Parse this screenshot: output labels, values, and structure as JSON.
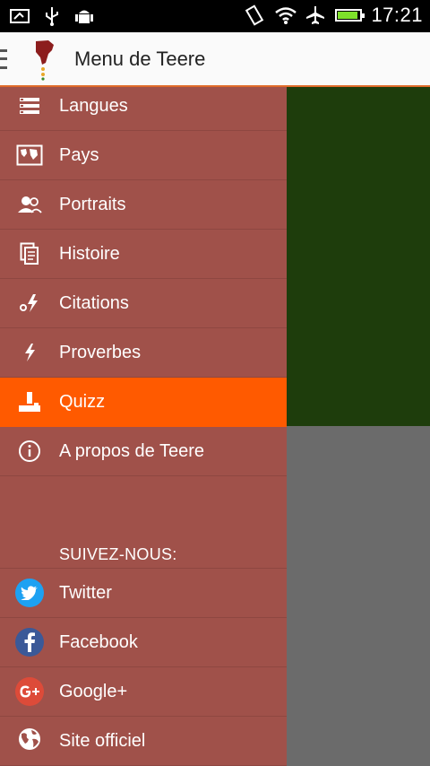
{
  "status_bar": {
    "time": "17:21",
    "icons": [
      "screenshot-icon",
      "usb-icon",
      "android-debug-icon",
      "rotate-icon",
      "wifi-icon",
      "airplane-icon",
      "battery-icon"
    ],
    "battery_level": 0.9
  },
  "action_bar": {
    "title": "Menu de Teere",
    "menu_icon": "hamburger-icon",
    "logo_icon": "africa-logo-icon"
  },
  "drawer": {
    "items": [
      {
        "label": "Langues",
        "icon": "list-icon"
      },
      {
        "label": "Pays",
        "icon": "map-icon"
      },
      {
        "label": "Portraits",
        "icon": "people-icon"
      },
      {
        "label": "Histoire",
        "icon": "document-icon"
      },
      {
        "label": "Citations",
        "icon": "quote-bolt-icon"
      },
      {
        "label": "Proverbes",
        "icon": "bolt-icon"
      },
      {
        "label": "Quizz",
        "icon": "joystick-icon",
        "active": true
      },
      {
        "label": "A propos de Teere",
        "icon": "info-icon"
      }
    ],
    "social_header": "SUIVEZ-NOUS:",
    "social": [
      {
        "label": "Twitter",
        "icon": "twitter-icon",
        "color": "#1da1f2"
      },
      {
        "label": "Facebook",
        "icon": "facebook-icon",
        "color": "#3b5998"
      },
      {
        "label": "Google+",
        "icon": "google-plus-icon",
        "color": "#dd4b39"
      },
      {
        "label": "Site officiel",
        "icon": "globe-icon"
      }
    ]
  },
  "colors": {
    "drawer_bg": "#a0514a",
    "active_bg": "#ff5a00",
    "content_green": "#1e3d0c",
    "scrim_gray": "#6b6b6b"
  }
}
